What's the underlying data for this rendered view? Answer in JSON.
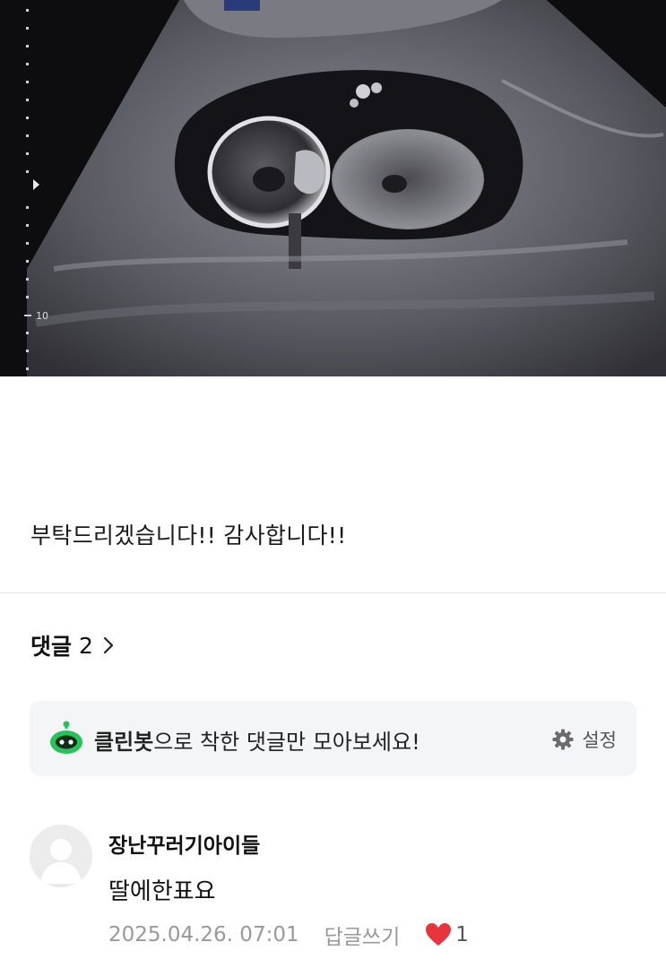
{
  "post": {
    "body_text": "부탁드리겠습니다!! 감사합니다!!",
    "image": {
      "depth_mark": "10"
    }
  },
  "comments_section": {
    "title": "댓글",
    "count": "2"
  },
  "cleanbot": {
    "name": "클린봇",
    "message": "으로 착한 댓글만 모아보세요!",
    "settings_label": "설정",
    "accent_color": "#27c25a"
  },
  "comments": [
    {
      "author": "장난꾸러기아이들",
      "content": "딸에한표요",
      "timestamp": "2025.04.26. 07:01",
      "reply_label": "답글쓰기",
      "like_count": "1",
      "like_color": "#e8343c"
    }
  ]
}
